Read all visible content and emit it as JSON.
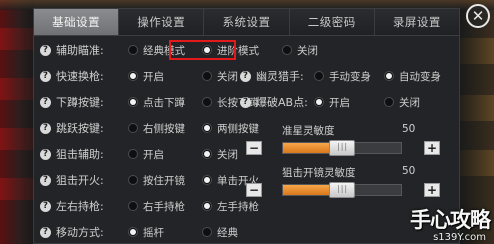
{
  "tabs": [
    "基础设置",
    "操作设置",
    "系统设置",
    "二级密码",
    "录屏设置"
  ],
  "rows": [
    {
      "label": "辅助瞄准:",
      "options": [
        "经典模式",
        "进阶模式",
        "关闭"
      ],
      "selected": 1
    },
    {
      "label": "快速换枪:",
      "options": [
        "开启",
        "关闭"
      ],
      "selected": 0
    },
    {
      "label": "下蹲按键:",
      "options": [
        "点击下蹲",
        "长按下蹲"
      ],
      "selected": 0
    },
    {
      "label": "跳跃按键:",
      "options": [
        "右侧按键",
        "两侧按键"
      ],
      "selected": 1
    },
    {
      "label": "狙击辅助:",
      "options": [
        "开启",
        "关闭"
      ],
      "selected": 1
    },
    {
      "label": "狙击开火:",
      "options": [
        "按住开镜",
        "单击开火"
      ],
      "selected": 1
    },
    {
      "label": "左右持枪:",
      "options": [
        "右手持枪",
        "左手持枪"
      ],
      "selected": 1
    },
    {
      "label": "移动方式:",
      "options": [
        "摇杆",
        "经典"
      ],
      "selected": 0
    }
  ],
  "right_rows": [
    {
      "label": "幽灵猎手:",
      "options": [
        "手动变身",
        "自动变身"
      ],
      "selected": 1
    },
    {
      "label": "爆破AB点:",
      "options": [
        "开启",
        "关闭"
      ],
      "selected": 0
    }
  ],
  "sliders": [
    {
      "title": "准星灵敏度",
      "value": "50",
      "level": 0.5
    },
    {
      "title": "狙击开镜灵敏度",
      "value": "50",
      "level": 0.5
    }
  ],
  "buttons": {
    "minus": "−",
    "plus": "+"
  },
  "watermark": {
    "logo": "手心攻略",
    "site": "s139Y.com"
  },
  "close_label": "✕",
  "colors": {
    "highlight": "#e21a1a",
    "accent": "#f39a3c",
    "active_tab": "#7d7f83"
  }
}
